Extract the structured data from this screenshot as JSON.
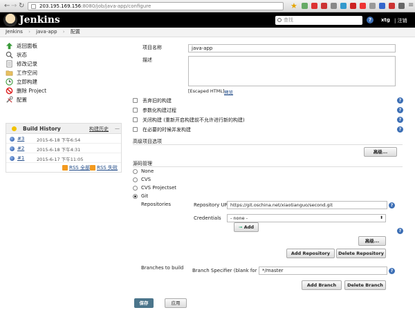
{
  "browser": {
    "url_host": "203.195.169.156",
    "url_path": ":8080/job/java-app/configure"
  },
  "header": {
    "brand": "Jenkins",
    "search_placeholder": "查找",
    "help_icon": "?",
    "user": "xtg",
    "logout": "| 注销"
  },
  "breadcrumb": [
    "Jenkins",
    "java-app",
    "配置"
  ],
  "sidebar": {
    "items": [
      {
        "label": "返回面板",
        "icon": "up-arrow-icon"
      },
      {
        "label": "状态",
        "icon": "search-icon"
      },
      {
        "label": "修改记录",
        "icon": "notepad-icon"
      },
      {
        "label": "工作空间",
        "icon": "folder-icon"
      },
      {
        "label": "立即构建",
        "icon": "clock-icon"
      },
      {
        "label": "删除 Project",
        "icon": "no-entry-icon"
      },
      {
        "label": "配置",
        "icon": "tools-icon"
      }
    ]
  },
  "build_history": {
    "title": "Build History",
    "trend": "构建历史",
    "trend_dash": "—",
    "builds": [
      {
        "num": "#3",
        "date": "2015-6-18 下午6:54"
      },
      {
        "num": "#2",
        "date": "2015-6-18 下午4:31"
      },
      {
        "num": "#1",
        "date": "2015-6-17 下午11:05"
      }
    ],
    "rss_all": "RSS 全部",
    "rss_fail": "RSS 失败"
  },
  "form": {
    "project_name_label": "项目名称",
    "project_name_value": "java-app",
    "description_label": "描述",
    "escaped_html": "[Escaped HTML]",
    "preview": "预览",
    "options": [
      "丢弃旧的构建",
      "参数化构建过程",
      "关闭构建 (重新开启构建前不允许进行新的构建)",
      "在必要的时候并发构建"
    ],
    "advanced_project_options": "高级项目选项",
    "advanced_button": "高级...",
    "scm_label": "源码管理",
    "scm_options": [
      "None",
      "CVS",
      "CVS Projectset",
      "Git"
    ],
    "repositories_label": "Repositories",
    "repo_url_label": "Repository URL",
    "repo_url_value": "https://git.oschina.net/xiaotianguo/second.git",
    "credentials_label": "Credentials",
    "credentials_value": "- none -",
    "add_button": "Add",
    "advanced_button2": "高级...",
    "add_repository": "Add Repository",
    "delete_repository": "Delete Repository",
    "branches_label": "Branches to build",
    "branch_specifier_label": "Branch Specifier (blank for 'any')",
    "branch_specifier_value": "*/master",
    "add_branch": "Add Branch",
    "delete_branch": "Delete Branch",
    "save": "保存",
    "apply": "应用"
  },
  "colors": {
    "header_bg": "#000000",
    "help_blue": "#3d6fb5",
    "save_blue": "#4b758b"
  }
}
